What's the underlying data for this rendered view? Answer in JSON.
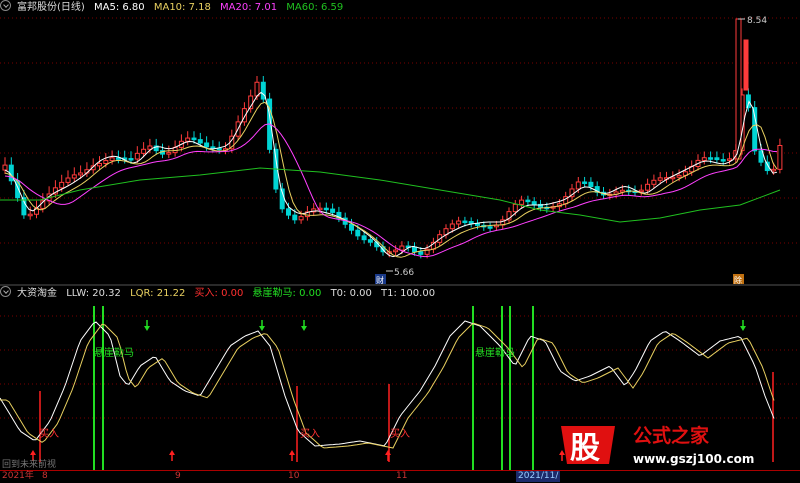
{
  "main_header": {
    "title": "富邦股份(日线)",
    "ma5": "MA5: 6.80",
    "ma10": "MA10: 7.18",
    "ma20": "MA20: 7.01",
    "ma60": "MA60: 6.59"
  },
  "main_annotations": {
    "high_label": "8.54",
    "low_label": "5.66",
    "badge_left": "财",
    "badge_right": "除"
  },
  "sub_header": {
    "title": "大资淘金",
    "llw": "LLW: 20.32",
    "lqr": "LQR: 21.22",
    "buy": "买入: 0.00",
    "xuanya": "悬崖勒马: 0.00",
    "t0": "T0: 0.00",
    "t1": "T1: 100.00"
  },
  "sub_labels": {
    "xuanya_1": "悬崖勒马",
    "xuanya_2": "悬崖勒马",
    "buy_1": "买入",
    "buy_2": "买入",
    "buy_3": "买入"
  },
  "x_axis": [
    "2021年",
    "8",
    "9",
    "10",
    "11",
    "2021/11/"
  ],
  "status_text": "回到未来前视",
  "watermark": {
    "glyph": "股",
    "name": "公式之家",
    "url": "www.gszj100.com"
  },
  "colors": {
    "up": "#ff3b3b",
    "down": "#00d4d4",
    "ma5": "#ffffff",
    "ma10": "#e8d060",
    "ma20": "#ff40ff",
    "ma60": "#20c020",
    "signal_green": "#22dd22",
    "signal_red": "#ff2020"
  }
}
